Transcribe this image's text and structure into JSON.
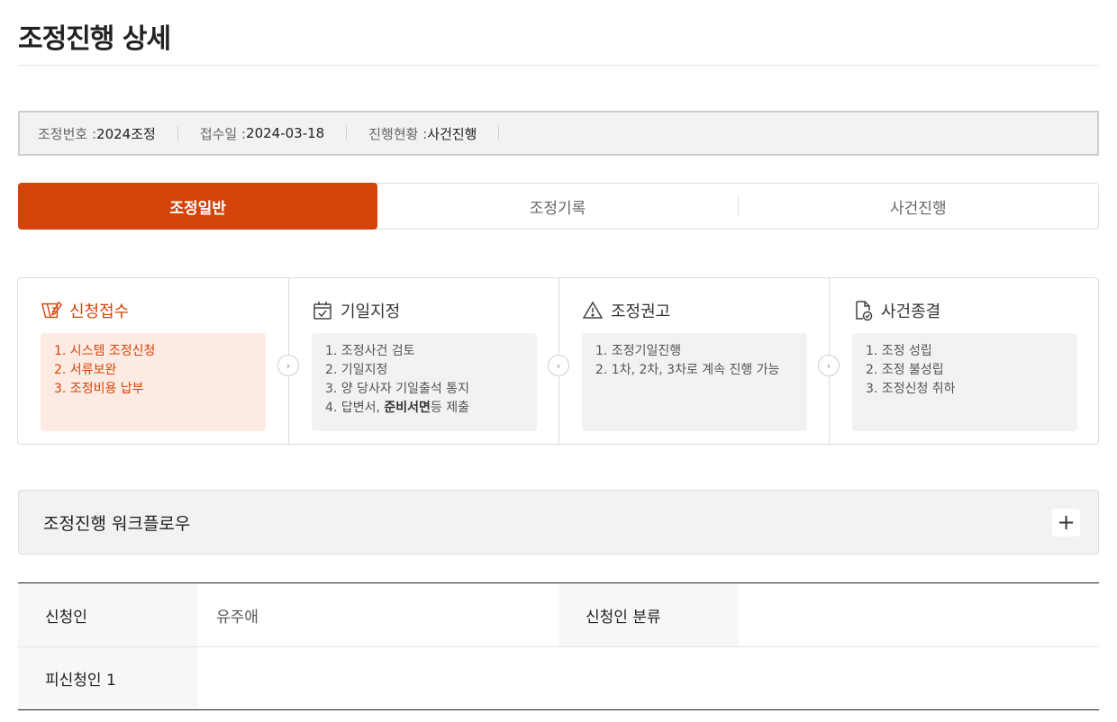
{
  "page": {
    "title": "조정진행 상세"
  },
  "info": {
    "case_no_label": "조정번호 : ",
    "case_no_value": "2024조정",
    "received_label": "접수일 : ",
    "received_value": "2024-03-18",
    "status_label": "진행현황 : ",
    "status_value": "사건진행"
  },
  "tabs": [
    {
      "label": "조정일반",
      "active": true
    },
    {
      "label": "조정기록",
      "active": false
    },
    {
      "label": "사건진행",
      "active": false
    }
  ],
  "steps": [
    {
      "title": "신청접수",
      "icon": "pen-document-icon",
      "active": true,
      "items": [
        "1. 시스템 조정신청",
        "2. 서류보완",
        "3. 조정비용 납부"
      ]
    },
    {
      "title": "기일지정",
      "icon": "calendar-check-icon",
      "active": false,
      "items": [
        "1. 조정사건 검토",
        "2. 기일지정",
        "3. 양 당사자 기일출석 통지",
        "4. 답변서, "
      ],
      "item4_bold": "준비서면",
      "item4_tail": "등 제출"
    },
    {
      "title": "조정권고",
      "icon": "warning-icon",
      "active": false,
      "items": [
        "1. 조정기일진행",
        "2. 1차, 2차, 3차로 계속 진행 가능"
      ]
    },
    {
      "title": "사건종결",
      "icon": "document-check-icon",
      "active": false,
      "items": [
        "1. 조정 성립",
        "2. 조정 불성립",
        "3. 조정신청 취하"
      ]
    }
  ],
  "workflow": {
    "title": "조정진행 워크플로우",
    "toggle": "+"
  },
  "table": {
    "applicant_label": "신청인",
    "applicant_value": "유주애",
    "applicant_type_label": "신청인 분류",
    "applicant_type_value": "",
    "respondent_label": "피신청인 1",
    "respondent_value": ""
  },
  "colors": {
    "accent": "#d4440a",
    "accent_light": "#fdebe3",
    "box_gray": "#f1f2f4"
  }
}
